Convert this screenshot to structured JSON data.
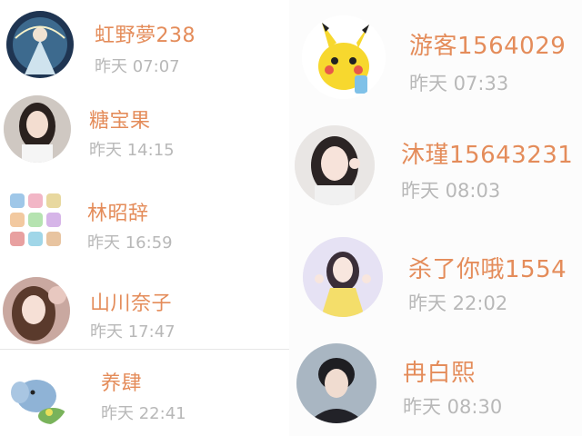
{
  "left_column": {
    "contacts": [
      {
        "name": "虹野夢238",
        "time": "昨天 07:07",
        "avatar": "fairy-illustration-avatar"
      },
      {
        "name": "糖宝果",
        "time": "昨天 14:15",
        "avatar": "girl-photo-avatar"
      },
      {
        "name": "林昭辞",
        "time": "昨天 16:59",
        "avatar": "sticker-grid-avatar"
      },
      {
        "name": "山川奈子",
        "time": "昨天 17:47",
        "avatar": "girl-portrait-avatar"
      },
      {
        "name": "养肆",
        "time": "昨天 22:41",
        "avatar": "cartoon-elephant-avatar"
      }
    ]
  },
  "right_column": {
    "contacts": [
      {
        "name": "游客1564029",
        "time": "昨天 07:33",
        "avatar": "pikachu-avatar"
      },
      {
        "name": "沐瑾15643231",
        "time": "昨天 08:03",
        "avatar": "girl-selfie-avatar"
      },
      {
        "name": "杀了你哦1554",
        "time": "昨天 22:02",
        "avatar": "girl-yellow-dress-avatar"
      },
      {
        "name": "冉白熙",
        "time": "昨天 08:30",
        "avatar": "boy-portrait-avatar"
      }
    ]
  },
  "colors": {
    "name_text": "#e48c5a",
    "time_text": "#b8b8b8",
    "divider": "#e6e6e6",
    "background": "#ffffff"
  }
}
